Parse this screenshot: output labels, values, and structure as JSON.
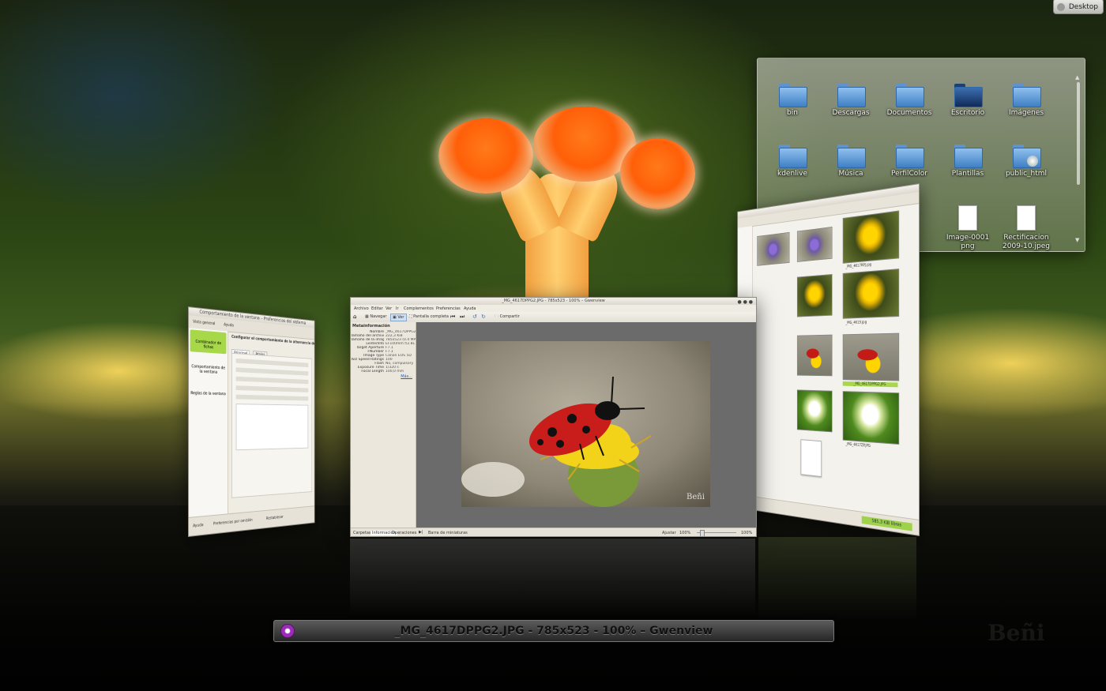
{
  "desktop_button": {
    "label": "Desktop",
    "icon": "desktop-icon"
  },
  "folder_view": {
    "items": [
      {
        "label": "bin",
        "type": "folder"
      },
      {
        "label": "Descargas",
        "type": "folder"
      },
      {
        "label": "Documentos",
        "type": "folder"
      },
      {
        "label": "Escritorio",
        "type": "folder-dark"
      },
      {
        "label": "Imágenes",
        "type": "folder"
      },
      {
        "label": "kdenlive",
        "type": "folder"
      },
      {
        "label": "Música",
        "type": "folder"
      },
      {
        "label": "PerfilColor",
        "type": "folder"
      },
      {
        "label": "Plantillas",
        "type": "folder"
      },
      {
        "label": "public_html",
        "type": "folder-web"
      },
      {
        "label": "Image-0001\npng",
        "type": "document"
      },
      {
        "label": "Rectificacion\n2009-10.jpeg",
        "type": "document"
      }
    ]
  },
  "system_settings": {
    "title": "Comportamiento de la ventana – Preferencias del sistema",
    "toolbar": [
      "Vista general",
      "Ayuda"
    ],
    "sidebar": [
      "Combinador de fichas",
      "Comportamiento de la ventana",
      "Reglas de la ventana"
    ],
    "heading": "Configurar el comportamiento de la alternancia de ventanas",
    "tabs": [
      "Principal",
      "Atajos"
    ],
    "footer": [
      "Ayuda",
      "Preferencias por omisión",
      "Restablecer"
    ]
  },
  "gwenview": {
    "title": "_MG_4617DPPG2.JPG - 785x523 - 100% – Gwenview",
    "menu": [
      "Archivo",
      "Editar",
      "Ver",
      "Ir",
      "Complementos",
      "Preferencias",
      "Ayuda"
    ],
    "toolbar": [
      "Navegar",
      "Ver",
      "Pantalla completa",
      "Compartir"
    ],
    "panel_title": "Metainformación",
    "meta": [
      {
        "k": "Nombre",
        "v": "_MG_4617DPPG2.J"
      },
      {
        "k": "Tamaño del archivo",
        "v": "222,3 KiB"
      },
      {
        "k": "Tamaño de la imagen",
        "v": "785x523 (0.4 MPx)"
      },
      {
        "k": "Lente/Info",
        "v": "EF100mm f/2.8L IS"
      },
      {
        "k": "Target Aperture",
        "v": "F7.1"
      },
      {
        "k": "FNumber",
        "v": "F7.1"
      },
      {
        "k": "Image Type",
        "v": "Canon EOS 5D"
      },
      {
        "k": "ISO Speed Ratings",
        "v": "100"
      },
      {
        "k": "Flash",
        "v": "No, compulsory"
      },
      {
        "k": "Exposure Time",
        "v": "1/320 s"
      },
      {
        "k": "Focal Length",
        "v": "100,0 mm"
      }
    ],
    "more_link": "Más...",
    "bottom_tabs": [
      "Carpetas",
      "Información",
      "Operaciones"
    ],
    "thumbbar_label": "Barra de miniaturas",
    "zoom_label": "Ajustar",
    "zoom_value": "100%",
    "zoom_value_right": "100%",
    "photo_watermark": "Beñi"
  },
  "browser": {
    "captions": [
      "_MG_4617RPJ.jpg",
      "_MG_4619.jpg",
      "_MG_4617DPPG2.JPG",
      "_MG_4617ZP.JPG",
      "_MG_4618.JPG",
      "_MG_4617DPPG2.JPG"
    ],
    "status": "585,3 KiB libres"
  },
  "taskbar": {
    "title": "_MG_4617DPPG2.JPG - 785x523 - 100% – Gwenview",
    "icon": "gwenview-icon"
  },
  "watermark": "Beñi",
  "colors": {
    "accent_folder": "#3f7fc4",
    "selected_green": "#a6d84a"
  }
}
